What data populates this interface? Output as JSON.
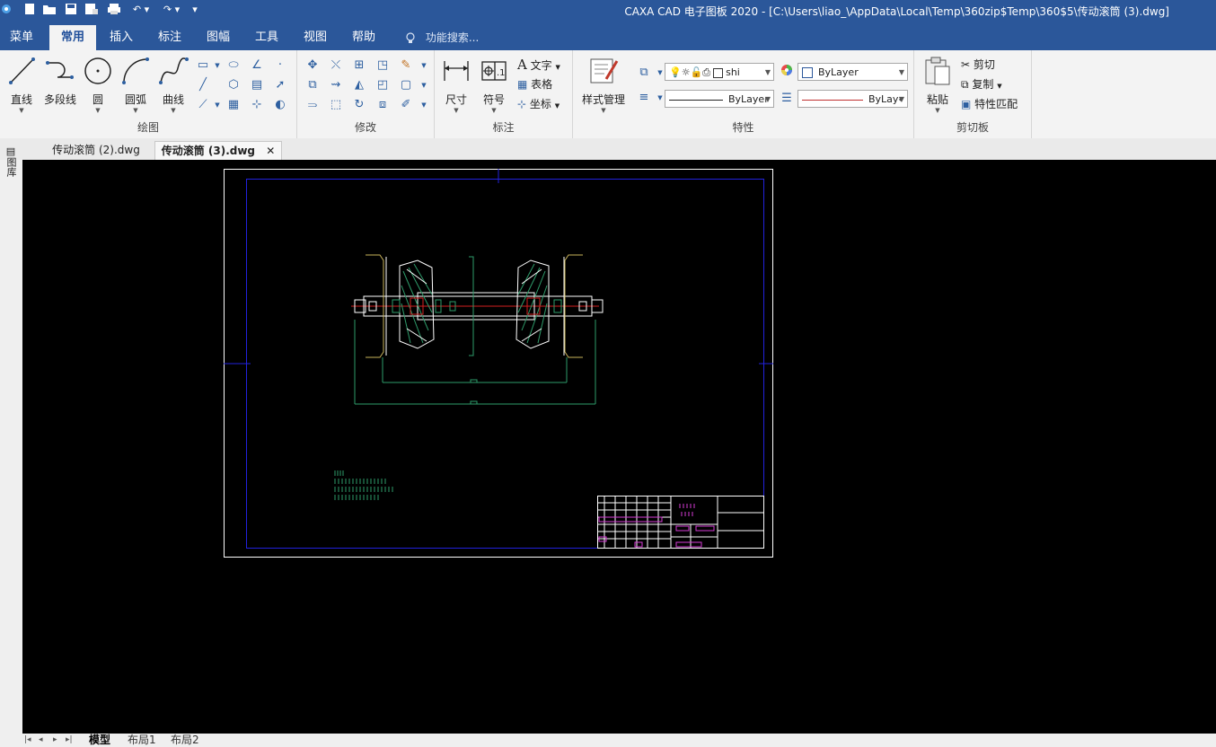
{
  "window": {
    "title": "CAXA CAD 电子图板 2020 - [C:\\Users\\liao_\\AppData\\Local\\Temp\\360zip$Temp\\360$5\\传动滚筒 (3).dwg]"
  },
  "quick_access": [
    "app-icon",
    "new-icon",
    "open-icon",
    "save-icon",
    "save-as-icon",
    "print-icon",
    "undo-icon",
    "redo-icon",
    "customize-icon"
  ],
  "menu": {
    "items": [
      "菜单",
      "常用",
      "插入",
      "标注",
      "图幅",
      "工具",
      "视图",
      "帮助"
    ],
    "active": "常用",
    "search_placeholder": "功能搜索..."
  },
  "ribbon": {
    "draw": {
      "label": "绘图",
      "buttons": [
        "直线",
        "多段线",
        "圆",
        "圆弧",
        "曲线"
      ]
    },
    "modify": {
      "label": "修改"
    },
    "annotate": {
      "label": "标注",
      "dimension": "尺寸",
      "symbol": "符号",
      "text": "文字",
      "table": "表格",
      "coordinate": "坐标"
    },
    "properties": {
      "label": "特性",
      "style_manager": "样式管理",
      "layer_name": "shi",
      "color_value": "ByLayer",
      "linetype_value": "ByLayer",
      "lineweight_value": "ByLay‹"
    },
    "clipboard": {
      "label": "剪切板",
      "paste": "粘贴",
      "cut": "剪切",
      "copy": "复制",
      "match": "特性匹配"
    }
  },
  "doc_tabs": [
    {
      "label": "传动滚筒 (2).dwg",
      "active": false
    },
    {
      "label": "传动滚筒 (3).dwg",
      "active": true
    }
  ],
  "side_panel": {
    "label": "图库"
  },
  "layout_tabs": [
    "模型",
    "布局1",
    "布局2"
  ],
  "colors": {
    "titlebar": "#2b579a",
    "canvas": "#000000",
    "frame_outer": "#ffffff",
    "frame_inner": "#2222dd",
    "drawing_white": "#ffffff",
    "drawing_green": "#2e9b6a",
    "drawing_magenta": "#d63bd6",
    "centerline_red": "#d22020",
    "dimension_yellow": "#c9b35a"
  }
}
